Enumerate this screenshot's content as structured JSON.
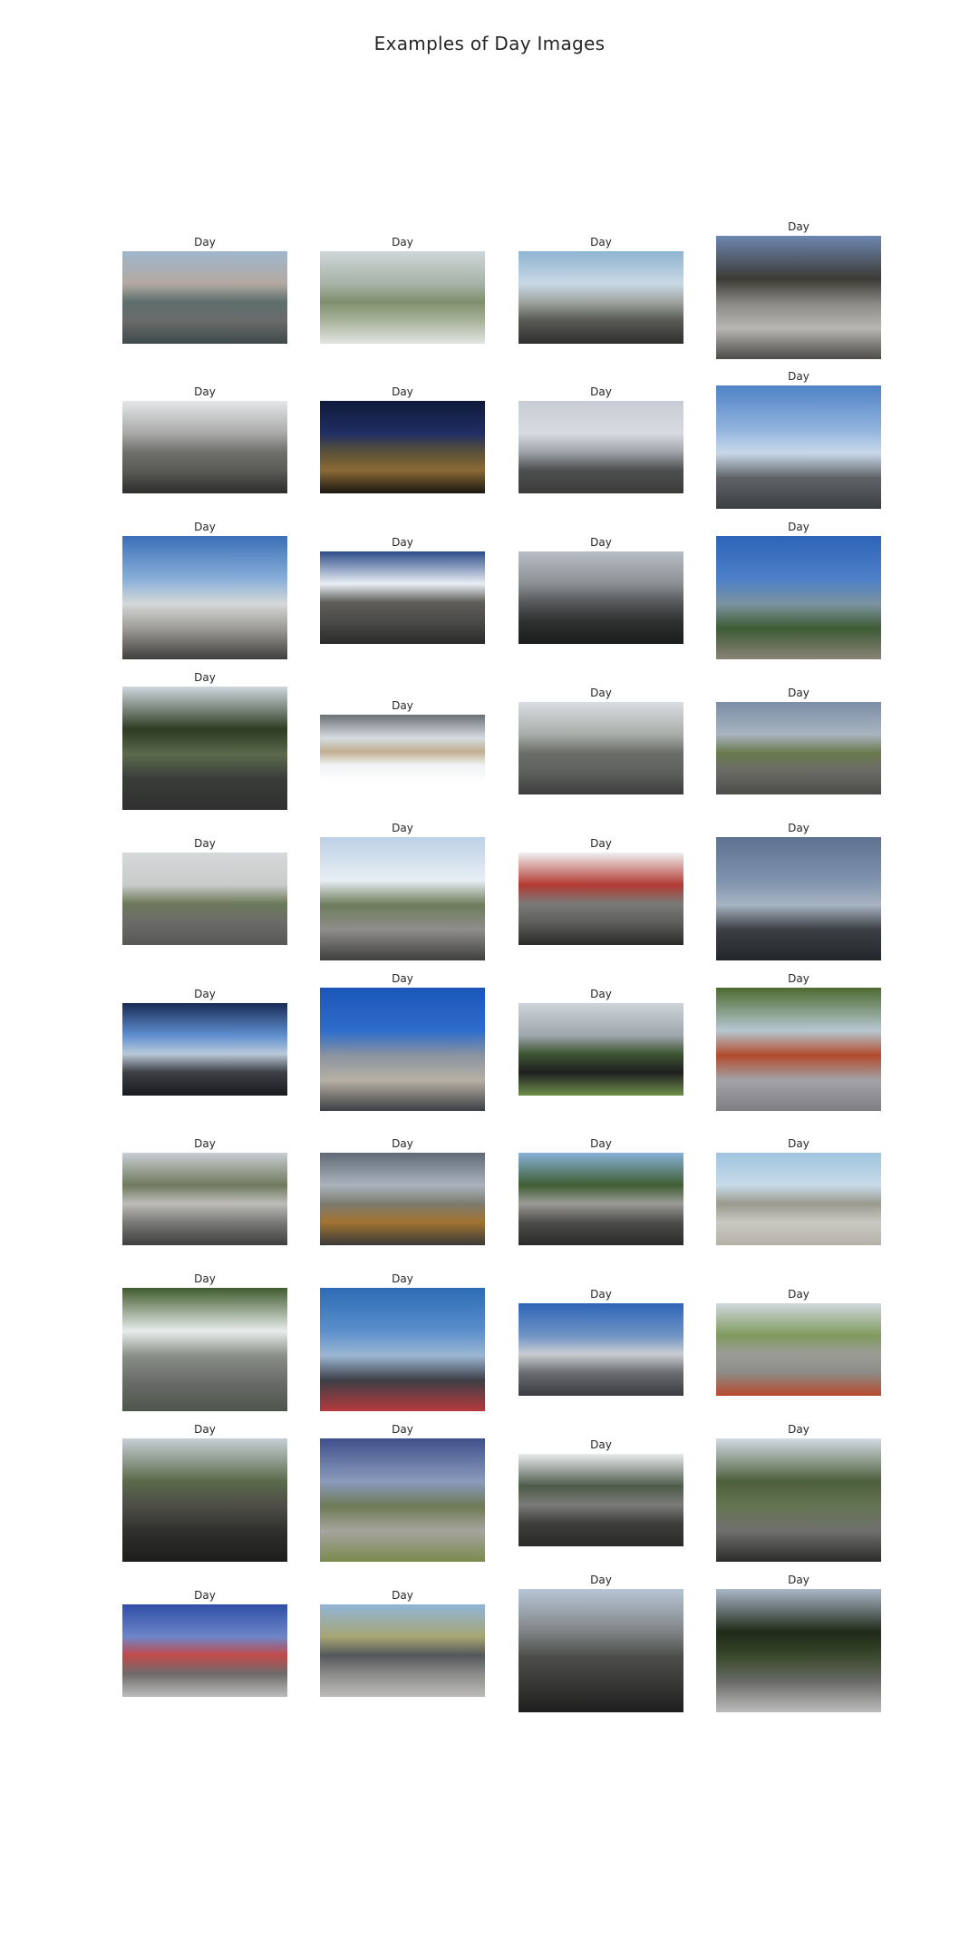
{
  "figure": {
    "title": "Examples of Day Images"
  },
  "images": [
    {
      "label": "Day",
      "colors": [
        "#9fb7cd",
        "#b4a9a2",
        "#5d6f6d",
        "#6a6a6a",
        "#3f4a4a"
      ]
    },
    {
      "label": "Day",
      "colors": [
        "#cfd6d9",
        "#a7b3a7",
        "#7f8f6d",
        "#a8b39a",
        "#e3e4e2"
      ]
    },
    {
      "label": "Day",
      "colors": [
        "#8fb4d1",
        "#c9d8e6",
        "#9da39d",
        "#5a5a55",
        "#2e2e2e"
      ]
    },
    {
      "label": "Day",
      "colors": [
        "#6d87b0",
        "#3c3a35",
        "#8b8a86",
        "#b7b6b3",
        "#4c4b48"
      ]
    },
    {
      "label": "Day",
      "colors": [
        "#e4e6e8",
        "#a9aaa8",
        "#6f6f6b",
        "#5b5b58",
        "#2d2d2d"
      ]
    },
    {
      "label": "Day",
      "colors": [
        "#101a3a",
        "#1f2e64",
        "#5a5038",
        "#8a6a35",
        "#1a1712"
      ]
    },
    {
      "label": "Day",
      "colors": [
        "#c8ccd4",
        "#d7dae1",
        "#a0a4a9",
        "#4e4f50",
        "#3b3b3a"
      ]
    },
    {
      "label": "Day",
      "colors": [
        "#4f83c6",
        "#8fb2dd",
        "#c9d8ea",
        "#5e6266",
        "#3d3f42"
      ]
    },
    {
      "label": "Day",
      "colors": [
        "#3b6fb7",
        "#89afd9",
        "#d5d8d8",
        "#9d9b97",
        "#403f3d"
      ]
    },
    {
      "label": "Day",
      "colors": [
        "#2d4d8a",
        "#e9eef4",
        "#5f5e5a",
        "#4b4b49",
        "#2b2b2b"
      ]
    },
    {
      "label": "Day",
      "colors": [
        "#b8bec6",
        "#8b9093",
        "#56585a",
        "#303131",
        "#1b1c1c"
      ]
    },
    {
      "label": "Day",
      "colors": [
        "#2e64b8",
        "#4c80c8",
        "#7c93a1",
        "#3d5c35",
        "#8a8276"
      ]
    },
    {
      "label": "Day",
      "colors": [
        "#cfd8de",
        "#2c3b22",
        "#5c6b4c",
        "#3a3c3a",
        "#2f302f"
      ]
    },
    {
      "label": "Day",
      "colors": [
        "#6a7074",
        "#d6dce1",
        "#bfae8e",
        "#f0f2f3",
        "#ffffff"
      ]
    },
    {
      "label": "Day",
      "colors": [
        "#d9dde1",
        "#a9ada9",
        "#6b6e69",
        "#5f615f",
        "#3c3d3c"
      ]
    },
    {
      "label": "Day",
      "colors": [
        "#7b8da6",
        "#a8b4c0",
        "#6b7a4e",
        "#6a6a66",
        "#4c4c4a"
      ]
    },
    {
      "label": "Day",
      "colors": [
        "#d6d8d9",
        "#c9cbcb",
        "#6d7b5a",
        "#6b6b69",
        "#575856"
      ]
    },
    {
      "label": "Day",
      "colors": [
        "#bcd0e6",
        "#e8eef4",
        "#6e7d5b",
        "#8e8d8b",
        "#3f3f3e"
      ]
    },
    {
      "label": "Day",
      "colors": [
        "#f0f1f2",
        "#b23a33",
        "#7a7a78",
        "#5f5f5d",
        "#2a2a28"
      ]
    },
    {
      "label": "Day",
      "colors": [
        "#5e7290",
        "#7e93ad",
        "#a7b3c2",
        "#3c3f44",
        "#23262b"
      ]
    },
    {
      "label": "Day",
      "colors": [
        "#182b55",
        "#5f8fd0",
        "#b9c9d9",
        "#3d3f45",
        "#1a1b1e"
      ]
    },
    {
      "label": "Day",
      "colors": [
        "#1a56b7",
        "#2f6dcc",
        "#8a93a0",
        "#b7b0a3",
        "#3c3f46"
      ]
    },
    {
      "label": "Day",
      "colors": [
        "#cdd4da",
        "#9ea6ac",
        "#3d5532",
        "#1f1f1f",
        "#6f8f4b"
      ]
    },
    {
      "label": "Day",
      "colors": [
        "#4d6a2f",
        "#b7c7d2",
        "#b24a2a",
        "#a4a3a8",
        "#7f7e83"
      ]
    },
    {
      "label": "Day",
      "colors": [
        "#c8ced3",
        "#6f7a5c",
        "#bdbcb9",
        "#7a7a78",
        "#3e3f3e"
      ]
    },
    {
      "label": "Day",
      "colors": [
        "#5f6a76",
        "#aab3bd",
        "#7c7c70",
        "#a27331",
        "#3a3a38"
      ]
    },
    {
      "label": "Day",
      "colors": [
        "#88b1d8",
        "#3f5e34",
        "#9b9a96",
        "#4e4e4c",
        "#2a2a2a"
      ]
    },
    {
      "label": "Day",
      "colors": [
        "#9fc4df",
        "#c7dbe9",
        "#9a9a8e",
        "#c9c8c2",
        "#b4b2a8"
      ]
    },
    {
      "label": "Day",
      "colors": [
        "#415c2e",
        "#e8eceb",
        "#8a8f88",
        "#6b6d6a",
        "#4e554b"
      ]
    },
    {
      "label": "Day",
      "colors": [
        "#2c6bb4",
        "#5b8fcc",
        "#9bb6d2",
        "#3d3f47",
        "#b63a3c"
      ]
    },
    {
      "label": "Day",
      "colors": [
        "#2f66b8",
        "#6f93c5",
        "#c9cdd1",
        "#6b6d70",
        "#3a3c40"
      ]
    },
    {
      "label": "Day",
      "colors": [
        "#d0d8dd",
        "#7f9a5d",
        "#9c9c97",
        "#8d8c87",
        "#b94a2e"
      ]
    },
    {
      "label": "Day",
      "colors": [
        "#c7cfd6",
        "#5a6a4a",
        "#4e4d48",
        "#2f2f2d",
        "#1d1d1c"
      ]
    },
    {
      "label": "Day",
      "colors": [
        "#3f4f8a",
        "#8a9bbd",
        "#6f7a55",
        "#a6a49e",
        "#7a8a4e"
      ]
    },
    {
      "label": "Day",
      "colors": [
        "#e8ecef",
        "#4e5b4a",
        "#7b7b78",
        "#3e3e3d",
        "#2a2a29"
      ]
    },
    {
      "label": "Day",
      "colors": [
        "#d3dbe3",
        "#4c5f3c",
        "#657553",
        "#6f6f6d",
        "#2b2b2a"
      ]
    },
    {
      "label": "Day",
      "colors": [
        "#2f4fa6",
        "#6d86c9",
        "#c24a4a",
        "#6e6b6a",
        "#bcbcbc"
      ]
    },
    {
      "label": "Day",
      "colors": [
        "#8fb6d8",
        "#a7a573",
        "#54585a",
        "#8b8b89",
        "#bdbcba"
      ]
    },
    {
      "label": "Day",
      "colors": [
        "#b7c6d6",
        "#7f8384",
        "#4c4d4b",
        "#3a3a39",
        "#1e1e1e"
      ]
    },
    {
      "label": "Day",
      "colors": [
        "#aab7c8",
        "#1f2a18",
        "#3a4a2c",
        "#6a6b68",
        "#bcbcbc"
      ]
    }
  ]
}
